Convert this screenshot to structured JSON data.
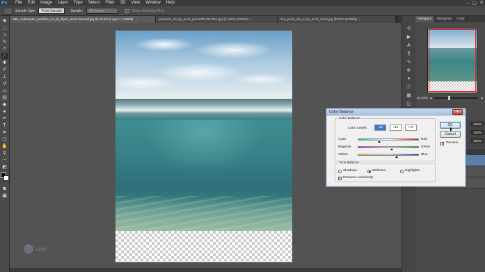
{
  "app": {
    "logo": "Ps"
  },
  "menu": [
    "File",
    "Edit",
    "Image",
    "Layer",
    "Type",
    "Select",
    "Filter",
    "3D",
    "View",
    "Window",
    "Help"
  ],
  "window_controls": {
    "minimize": "–",
    "restore": "▢",
    "close": "✕"
  },
  "options_bar": {
    "sample_size_label": "Sample Size:",
    "sample_size_value": "Point Sample",
    "sample_label": "Sample:",
    "sample_value": "All Layers",
    "show_ring_label": "Show Sampling Ring"
  },
  "tabs": [
    {
      "label": "480_underwater_partition_01_by_frjorn_stock-d4e4wf.jpg @ 32.5% (Layer 1, RGB/8)",
      "close": "×",
      "active": true
    },
    {
      "label": "premade_10_by_punz_jnews0f9-d5t.lh5b.jpg @ 100% (RGB/8)",
      "close": "×",
      "active": false
    },
    {
      "label": "sea_pond_sky_2_by_archi_stock.jpg @ 50% (RGB/8)",
      "close": "×",
      "active": false
    }
  ],
  "panels": {
    "navigator_tabs": [
      "Navigator",
      "Histogram",
      "Color"
    ],
    "zoom_value": "32.46%",
    "layer_tabs": [
      "Layers",
      "Channels",
      "Paths"
    ],
    "adjust_values": [
      "100%",
      "100%",
      "100%"
    ]
  },
  "watermark": {
    "text": "rafy"
  },
  "dialog": {
    "title": "Color Balance",
    "close": "✕",
    "color_balance_group": "Color Balance",
    "color_levels_label": "Color Levels:",
    "color_levels": [
      "-30",
      "+11",
      "+27"
    ],
    "sliders": [
      {
        "left": "Cyan",
        "right": "Red",
        "value": -30
      },
      {
        "left": "Magenta",
        "right": "Green",
        "value": 11
      },
      {
        "left": "Yellow",
        "right": "Blue",
        "value": 27
      }
    ],
    "tone_balance_group": "Tone Balance",
    "tones": [
      "Shadows",
      "Midtones",
      "Highlights"
    ],
    "selected_tone": "Midtones",
    "preserve_luminosity_label": "Preserve Luminosity",
    "preserve_luminosity": true,
    "ok_label": "OK",
    "cancel_label": "Cancel",
    "preview_label": "Preview",
    "preview_checked": true,
    "checkmark": "✓"
  },
  "colors": {
    "accent": "#3a78d4",
    "workspace": "#535353",
    "panel": "#4a4a4a",
    "dialog_bg": "#f0f0f0"
  }
}
